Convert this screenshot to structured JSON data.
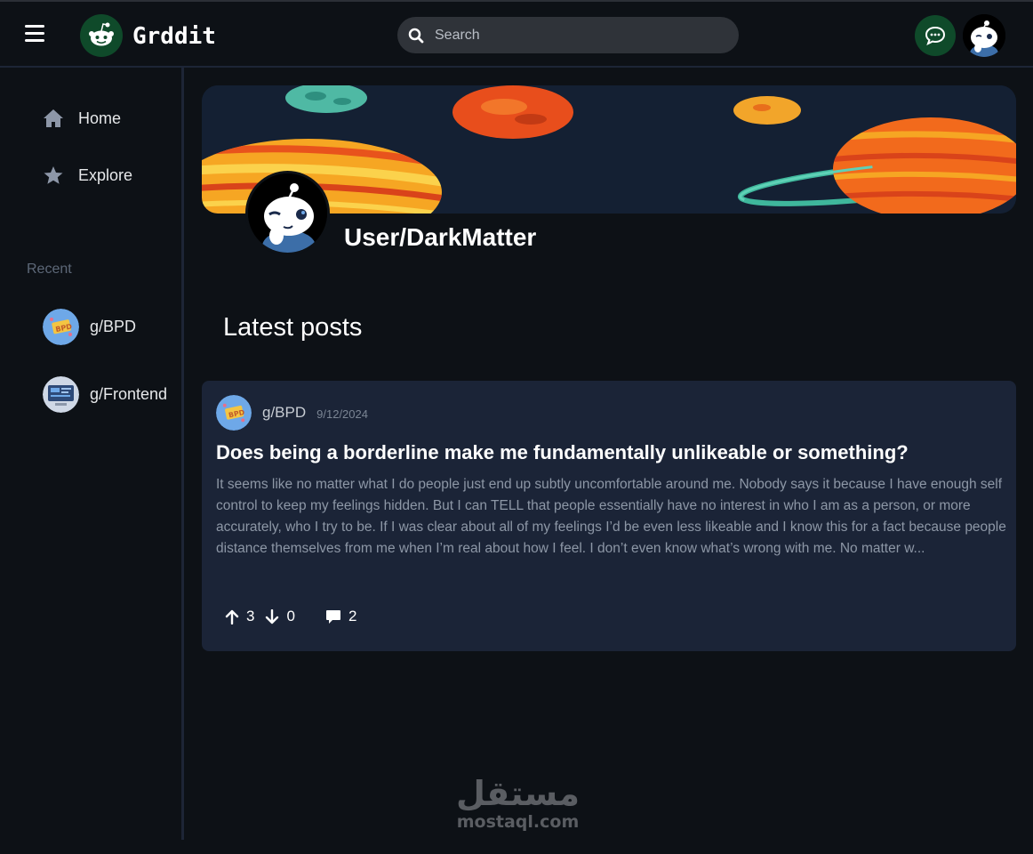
{
  "header": {
    "app_name": "Grddit",
    "search_placeholder": "Search",
    "menu_icon": "hamburger-icon",
    "logo_icon": "reddit-alien-icon",
    "chat_icon": "chat-icon"
  },
  "sidebar": {
    "nav": [
      {
        "label": "Home",
        "icon": "home-icon"
      },
      {
        "label": "Explore",
        "icon": "star-icon"
      }
    ],
    "recent_label": "Recent",
    "recent": [
      {
        "label": "g/BPD"
      },
      {
        "label": "g/Frontend"
      }
    ]
  },
  "profile": {
    "username": "User/DarkMatter"
  },
  "main": {
    "section_title": "Latest posts"
  },
  "posts": [
    {
      "community": "g/BPD",
      "date": "9/12/2024",
      "title": "Does being a borderline make me fundamentally unlikeable or something?",
      "body": "It seems like no matter what I do people just end up subtly uncomfortable around me. Nobody says it because I have enough self control to keep my feelings hidden. But I can TELL that people essentially have no interest in who I am as a person, or more accurately, who I try to be. If I was clear about all of my feelings I’d be even less likeable and I know this for a fact because people distance themselves from me when I’m real about how I feel. I don’t even know what’s wrong with me. No matter w...",
      "upvotes": "3",
      "downvotes": "0",
      "comments": "2"
    }
  ],
  "watermark": {
    "arabic": "مستقل",
    "latin": "mostaql.com"
  },
  "colors": {
    "background": "#0d1116",
    "card": "#1b2437",
    "accent_green": "#0f4a2a",
    "divider": "#1d2536"
  }
}
